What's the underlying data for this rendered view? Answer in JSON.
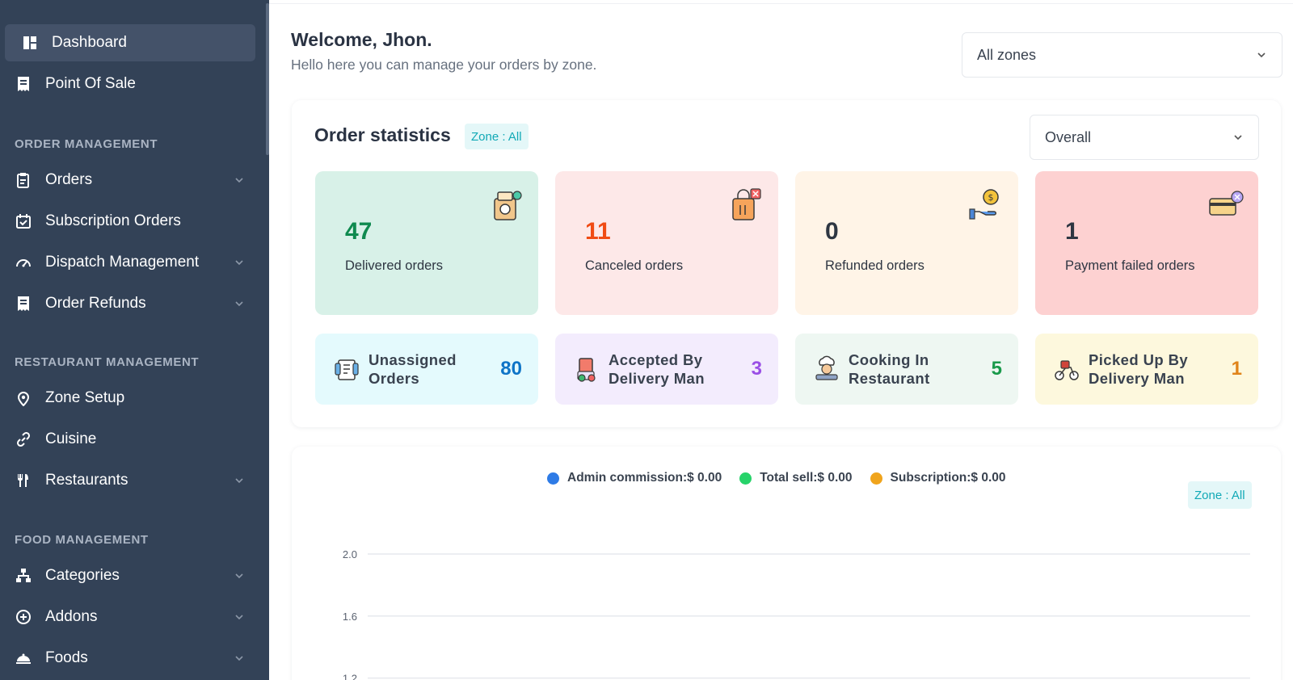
{
  "sidebar": {
    "items": [
      {
        "label": "Dashboard",
        "icon": "dashboard-icon",
        "active": true
      },
      {
        "label": "Point Of Sale",
        "icon": "receipt-icon"
      },
      {
        "label": "Orders",
        "icon": "orders-icon",
        "has_children": true
      },
      {
        "label": "Subscription Orders",
        "icon": "calendar-check-icon"
      },
      {
        "label": "Dispatch Management",
        "icon": "speedometer-icon",
        "has_children": true
      },
      {
        "label": "Order Refunds",
        "icon": "receipt-icon",
        "has_children": true
      },
      {
        "label": "Zone Setup",
        "icon": "map-pin-icon"
      },
      {
        "label": "Cuisine",
        "icon": "link-icon"
      },
      {
        "label": "Restaurants",
        "icon": "fork-knife-icon",
        "has_children": true
      },
      {
        "label": "Categories",
        "icon": "hierarchy-icon",
        "has_children": true
      },
      {
        "label": "Addons",
        "icon": "plus-circle-icon",
        "has_children": true
      },
      {
        "label": "Foods",
        "icon": "food-cover-icon",
        "has_children": true
      }
    ],
    "sections": {
      "order_management": "ORDER MANAGEMENT",
      "restaurant_management": "RESTAURANT MANAGEMENT",
      "food_management": "FOOD MANAGEMENT"
    }
  },
  "header": {
    "title": "Welcome, Jhon.",
    "subtitle": "Hello here you can manage your orders by zone.",
    "zone_select": "All zones"
  },
  "stats": {
    "title": "Order statistics",
    "zone_badge": "Zone : All",
    "period_select": "Overall",
    "cards": [
      {
        "value": "47",
        "label": "Delivered orders",
        "bg": "#d8f1e8",
        "color": "#0f8a4f"
      },
      {
        "value": "11",
        "label": "Canceled orders",
        "bg": "#fde8e8",
        "color": "#f04b14"
      },
      {
        "value": "0",
        "label": "Refunded orders",
        "bg": "#fff4e7",
        "color": "#2e3642"
      },
      {
        "value": "1",
        "label": "Payment failed orders",
        "bg": "#fdd1d1",
        "color": "#2e3642"
      }
    ],
    "small_cards": [
      {
        "label_line1": "Unassigned",
        "label_line2": "Orders",
        "value": "80",
        "bg": "#e4fafd",
        "color": "#0e74c7"
      },
      {
        "label_line1": "Accepted By",
        "label_line2": "Delivery Man",
        "value": "3",
        "bg": "#f3ecfd",
        "color": "#9a4fe6"
      },
      {
        "label_line1": "Cooking In",
        "label_line2": "Restaurant",
        "value": "5",
        "bg": "#eef7f2",
        "color": "#1a9a4b"
      },
      {
        "label_line1": "Picked Up By",
        "label_line2": "Delivery Man",
        "value": "1",
        "bg": "#fdf8dd",
        "color": "#e0841a"
      }
    ]
  },
  "chart": {
    "zone_badge": "Zone : All",
    "legend": [
      {
        "label": "Admin commission:$ 0.00",
        "color": "#2e7be6"
      },
      {
        "label": "Total sell:$ 0.00",
        "color": "#27d36a"
      },
      {
        "label": "Subscription:$ 0.00",
        "color": "#f0a41c"
      }
    ]
  },
  "chart_data": {
    "type": "line",
    "series": [
      {
        "name": "Admin commission:$ 0.00",
        "values": []
      },
      {
        "name": "Total sell:$ 0.00",
        "values": []
      },
      {
        "name": "Subscription:$ 0.00",
        "values": []
      }
    ],
    "y_ticks": [
      "2.0",
      "1.6",
      "1.2"
    ],
    "ylim": [
      1.2,
      2.0
    ],
    "grid": true,
    "legend_position": "top"
  }
}
